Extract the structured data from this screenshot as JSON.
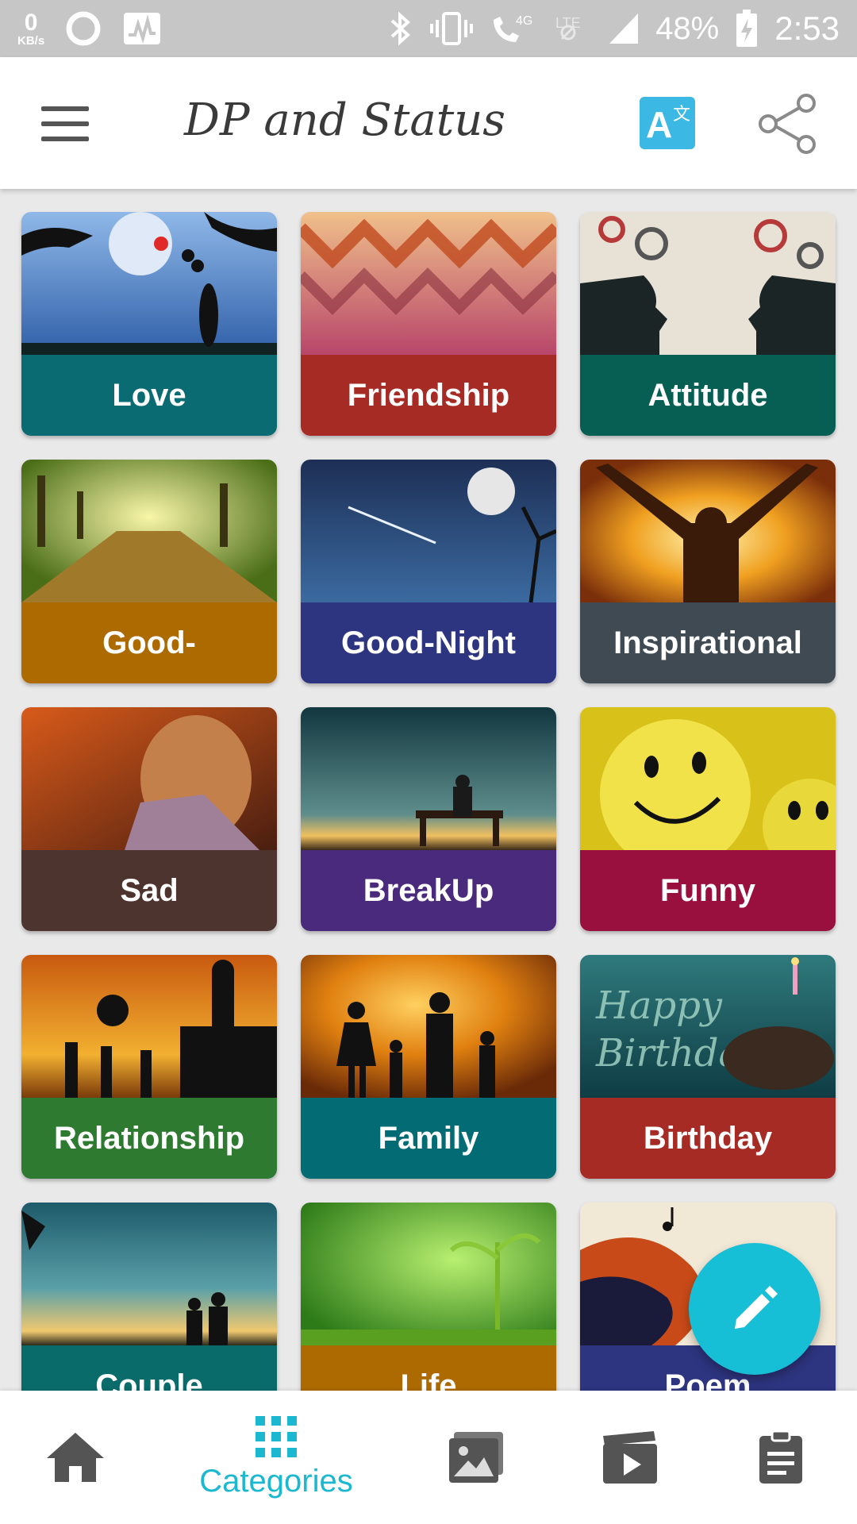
{
  "status_bar": {
    "net_speed_value": "0",
    "net_speed_unit": "KB/s",
    "battery": "48%",
    "time": "2:53",
    "net_type": "4G"
  },
  "app_bar": {
    "title": "DP and Status",
    "translate_icon_letter": "A",
    "translate_icon_glyph": "文"
  },
  "categories": [
    {
      "label": "Love",
      "color": "#0b6b73"
    },
    {
      "label": "Friendship",
      "color": "#a72b25"
    },
    {
      "label": "Attitude",
      "color": "#075e53"
    },
    {
      "label": "Good-",
      "color": "#ad6a00"
    },
    {
      "label": "Good-Night",
      "color": "#2e3580"
    },
    {
      "label": "Inspirational",
      "color": "#3f4a52"
    },
    {
      "label": "Sad",
      "color": "#4e342e"
    },
    {
      "label": "BreakUp",
      "color": "#4a2a7c"
    },
    {
      "label": "Funny",
      "color": "#990f3d"
    },
    {
      "label": "Relationship",
      "color": "#2e7a30"
    },
    {
      "label": "Family",
      "color": "#036b73"
    },
    {
      "label": "Birthday",
      "color": "#a72b25"
    },
    {
      "label": "Couple",
      "color": "#0a6b6b"
    },
    {
      "label": "Life",
      "color": "#ad6a00"
    },
    {
      "label": "Poem",
      "color": "#2e3580"
    }
  ],
  "bottom_nav": {
    "categories_label": "Categories",
    "active_color": "#1bb8cf",
    "icon_color": "#545454"
  }
}
